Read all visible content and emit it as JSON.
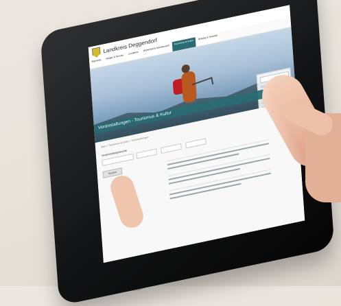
{
  "screen": {
    "brand": "Landkreis Deggendorf",
    "menu": [
      "Startseite",
      "Bürger & Service",
      "Landkreis",
      "Wirtschaft & Arbeitsmarkt",
      "Tourismus & Kultur",
      "Bildung & Soziales"
    ],
    "hero_title": "Veranstaltungen - Tourismus & Kultur",
    "breadcrumb": "Start > Tourismus & Kultur > Veranstaltungen",
    "form": {
      "label": "Veranstaltungssuche",
      "button": "Suchen"
    }
  }
}
